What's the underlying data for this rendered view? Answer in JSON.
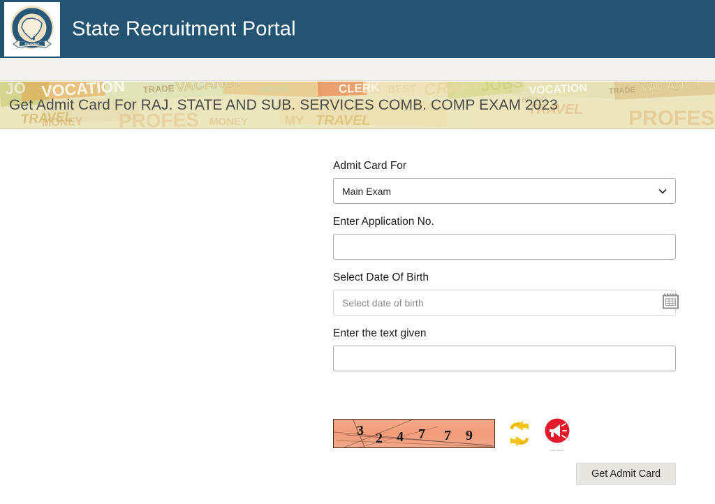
{
  "header": {
    "title": "State Recruitment Portal",
    "logo_alt": "State Recruitment Portal Rajasthan emblem",
    "logo_ring_text_left": "State",
    "logo_ring_text_top": "Recruitment",
    "logo_ring_text_right": "Portal",
    "logo_banner_text": "Rajasthan",
    "background_color": "#255372"
  },
  "banner": {
    "title": "Get Admit Card For RAJ. STATE AND SUB. SERVICES COMB. COMP EXAM 2023",
    "background_color": "#ece6bf",
    "collage_words": [
      "VOCATION",
      "TRADE",
      "VACANCY",
      "CLERK",
      "BEST",
      "CRAFT",
      "MONEY",
      "MY",
      "TRAVEL",
      "PROFESSION",
      "HIRING",
      "JOBS"
    ]
  },
  "form": {
    "admit_card_for": {
      "label": "Admit Card For",
      "selected": "Main Exam",
      "options": [
        "Main Exam"
      ]
    },
    "application_no": {
      "label": "Enter Application No.",
      "value": "",
      "placeholder": ""
    },
    "date_of_birth": {
      "label": "Select Date Of Birth",
      "value": "",
      "placeholder": "Select date of birth",
      "icon": "calendar-icon"
    },
    "captcha_text": {
      "label": "Enter the text given",
      "value": "",
      "placeholder": ""
    }
  },
  "captcha": {
    "code": "324779",
    "digits": [
      "3",
      "2",
      "4",
      "7",
      "7",
      "9"
    ],
    "refresh_icon": "refresh-arrows-icon",
    "audio_icon": "audio-speaker-icon",
    "audio_caption": "Audio Captcha"
  },
  "actions": {
    "submit_label": "Get Admit Card"
  },
  "colors": {
    "header": "#255372",
    "banner": "#ece6bf",
    "captcha_bg": "#f3a183",
    "refresh": "#f5c518",
    "audio": "#e8192c",
    "button": "#e8e6e0"
  }
}
